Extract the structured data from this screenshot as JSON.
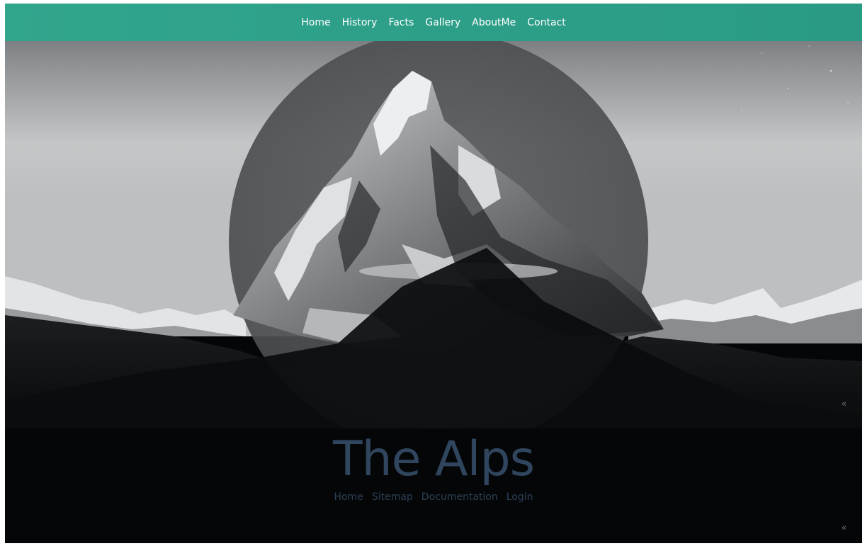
{
  "nav": {
    "items": [
      {
        "label": "Home"
      },
      {
        "label": "History"
      },
      {
        "label": "Facts"
      },
      {
        "label": "Gallery"
      },
      {
        "label": "AboutMe"
      },
      {
        "label": "Contact"
      }
    ]
  },
  "hero": {
    "title": "The Alps"
  },
  "footer_nav": {
    "items": [
      {
        "label": "Home"
      },
      {
        "label": "Sitemap"
      },
      {
        "label": "Documentation"
      },
      {
        "label": "Login"
      }
    ]
  },
  "colors": {
    "nav_bar": "#2d9f89",
    "title": "#2f465e",
    "footer_link": "#2c4156",
    "background": "#050607"
  },
  "icons": {
    "scroll_arrow_upper": "double-chevron-left-icon",
    "scroll_arrow_lower": "double-chevron-left-icon"
  }
}
